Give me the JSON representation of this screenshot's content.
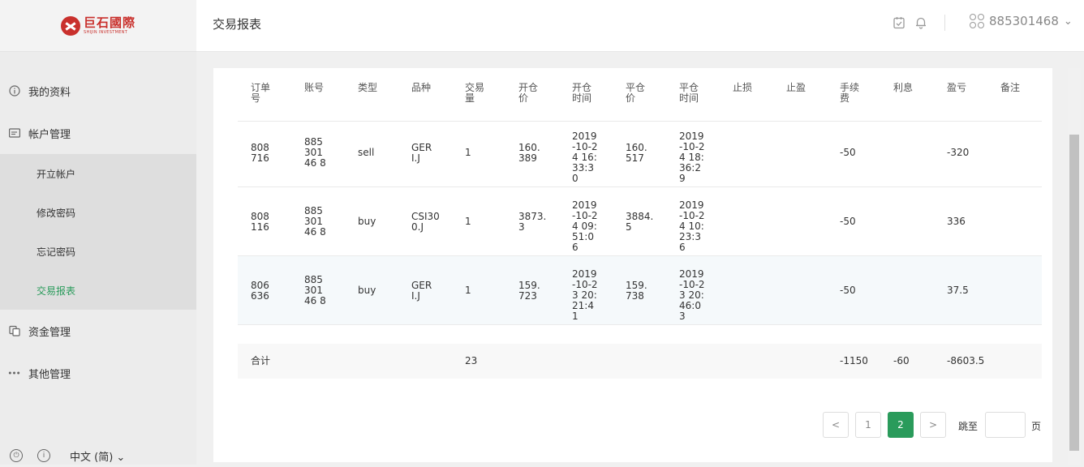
{
  "brand": {
    "name_cn": "巨石國際",
    "name_en": "SHIJIN INVESTMENT"
  },
  "header": {
    "title": "交易报表",
    "username": "885301468"
  },
  "sidebar": {
    "items": [
      {
        "label": "我的资料",
        "icon": "info-icon"
      },
      {
        "label": "帐户管理",
        "icon": "card-icon"
      }
    ],
    "subitems": [
      {
        "label": "开立帐户"
      },
      {
        "label": "修改密码"
      },
      {
        "label": "忘记密码"
      },
      {
        "label": "交易报表"
      }
    ],
    "items_after": [
      {
        "label": "资金管理",
        "icon": "funds-icon"
      },
      {
        "label": "其他管理",
        "icon": "more-icon"
      }
    ],
    "language": "中文 (简)"
  },
  "table": {
    "columns": [
      "订单号",
      "账号",
      "类型",
      "品种",
      "交易量",
      "开仓价",
      "开仓时间",
      "平仓价",
      "平仓时间",
      "止损",
      "止盈",
      "手续费",
      "利息",
      "盈亏",
      "备注"
    ],
    "rows": [
      [
        "808716",
        "88530146 8",
        "sell",
        "GERI.J",
        "1",
        "160.389",
        "2019-10-24 16:33:30",
        "160.517",
        "2019-10-24 18:36:29",
        "",
        "",
        "-50",
        "",
        "-320",
        ""
      ],
      [
        "808116",
        "88530146 8",
        "buy",
        "CSI300.J",
        "1",
        "3873.3",
        "2019-10-24 09:51:06",
        "3884.5",
        "2019-10-24 10:23:36",
        "",
        "",
        "-50",
        "",
        "336",
        ""
      ],
      [
        "806636",
        "88530146 8",
        "buy",
        "GERI.J",
        "1",
        "159.723",
        "2019-10-23 20:21:41",
        "159.738",
        "2019-10-23 20:46:03",
        "",
        "",
        "-50",
        "",
        "37.5",
        ""
      ]
    ],
    "summary": {
      "label": "合计",
      "volume": "23",
      "fee": "-1150",
      "interest": "-60",
      "pnl": "-8603.5"
    }
  },
  "pagination": {
    "prev": "<",
    "next": ">",
    "pages": [
      "1",
      "2"
    ],
    "current": "2",
    "jump_label": "跳至",
    "jump_suffix": "页",
    "jump_value": ""
  },
  "colors": {
    "accent": "#2a9b5b",
    "brand": "#c9302c"
  }
}
